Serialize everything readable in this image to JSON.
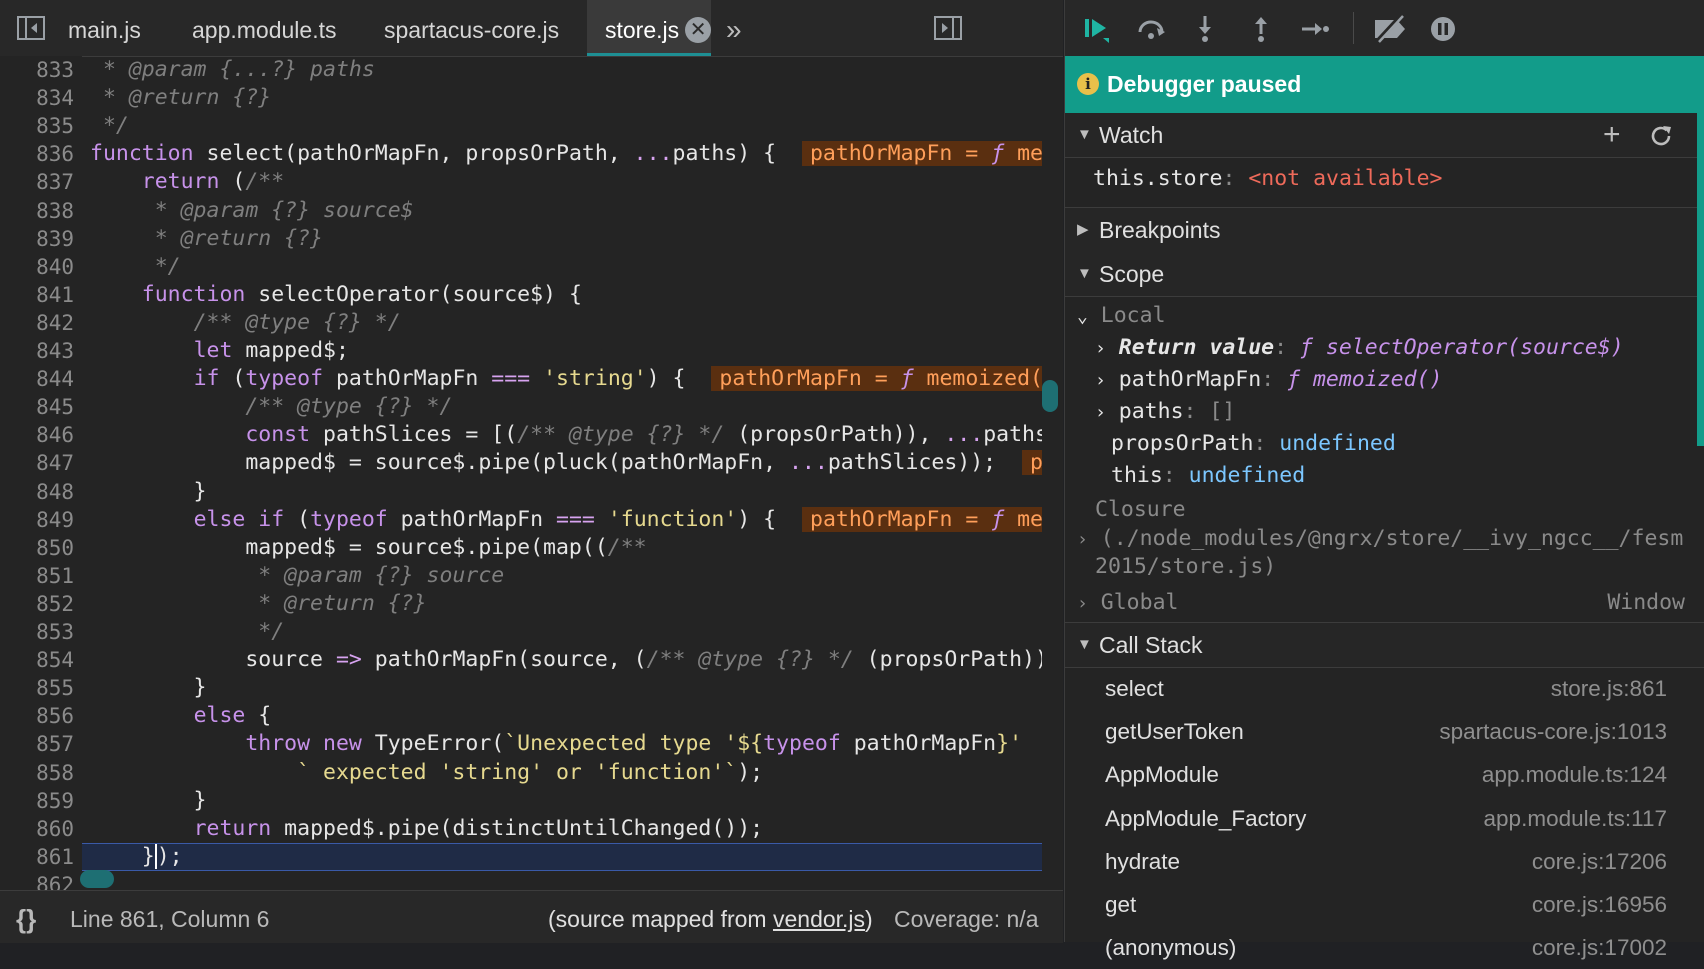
{
  "tabs": [
    {
      "label": "main.js"
    },
    {
      "label": "app.module.ts"
    },
    {
      "label": "spartacus-core.js"
    },
    {
      "label": "store.js",
      "active": true
    }
  ],
  "tab_close_glyph": "✕",
  "tab_overflow_glyph": "»",
  "code": {
    "lines": [
      {
        "n": "833",
        "html": "<span class=\"cm\"> * @param {...?} paths</span>"
      },
      {
        "n": "834",
        "html": "<span class=\"cm\"> * @return {?}</span>"
      },
      {
        "n": "835",
        "html": "<span class=\"cm\"> */</span>"
      },
      {
        "n": "836",
        "html": "<span class=\"kw\">function</span> select(pathOrMapFn, propsOrPath, <span class=\"op\">...</span>paths) {  <span class=\"inl\">pathOrMapFn = <span class=\"fn\">ƒ</span> memoized()</span>"
      },
      {
        "n": "837",
        "html": "    <span class=\"kw\">return</span> (<span class=\"cm\">/**</span>"
      },
      {
        "n": "838",
        "html": "<span class=\"cm\">     * @param {?} source$</span>"
      },
      {
        "n": "839",
        "html": "<span class=\"cm\">     * @return {?}</span>"
      },
      {
        "n": "840",
        "html": "<span class=\"cm\">     */</span>"
      },
      {
        "n": "841",
        "html": "    <span class=\"kw\">function</span> selectOperator(source$) {"
      },
      {
        "n": "842",
        "html": "        <span class=\"cm\">/** @type {?} */</span>"
      },
      {
        "n": "843",
        "html": "        <span class=\"kw\">let</span> mapped$;"
      },
      {
        "n": "844",
        "html": "        <span class=\"kw\">if</span> (<span class=\"kw\">typeof</span> pathOrMapFn <span class=\"op\">===</span> <span class=\"str\">'string'</span>) {  <span class=\"inl\">pathOrMapFn = <span class=\"fn\">ƒ</span> memoized()</span>"
      },
      {
        "n": "845",
        "html": "            <span class=\"cm\">/** @type {?} */</span>"
      },
      {
        "n": "846",
        "html": "            <span class=\"kw\">const</span> pathSlices = [(<span class=\"cm\">/** @type {?} */</span> (propsOrPath)), <span class=\"op\">...</span>paths];"
      },
      {
        "n": "847",
        "html": "            mapped$ = source$.pipe(pluck(pathOrMapFn, <span class=\"op\">...</span>pathSlices));  <span class=\"inl\">pathSlices</span>"
      },
      {
        "n": "848",
        "html": "        }"
      },
      {
        "n": "849",
        "html": "        <span class=\"kw\">else if</span> (<span class=\"kw\">typeof</span> pathOrMapFn <span class=\"op\">===</span> <span class=\"str\">'function'</span>) {  <span class=\"inl\">pathOrMapFn = <span class=\"fn\">ƒ</span> memoized()</span>"
      },
      {
        "n": "850",
        "html": "            mapped$ = source$.pipe(map((<span class=\"cm\">/**</span>"
      },
      {
        "n": "851",
        "html": "<span class=\"cm\">             * @param {?} source</span>"
      },
      {
        "n": "852",
        "html": "<span class=\"cm\">             * @return {?}</span>"
      },
      {
        "n": "853",
        "html": "<span class=\"cm\">             */</span>"
      },
      {
        "n": "854",
        "html": "            source <span class=\"op\">=></span> pathOrMapFn(source, (<span class=\"cm\">/** @type {?} */</span> (propsOrPath)))));"
      },
      {
        "n": "855",
        "html": "        }"
      },
      {
        "n": "856",
        "html": "        <span class=\"kw\">else</span> {"
      },
      {
        "n": "857",
        "html": "            <span class=\"kw\">throw new</span> TypeError(<span class=\"str\">`Unexpected type '${</span><span class=\"kw\">typeof</span> pathOrMapFn<span class=\"str\">}'</span>"
      },
      {
        "n": "858",
        "html": "<span class=\"str\">                ` expected 'string' or 'function'`</span>);"
      },
      {
        "n": "859",
        "html": "        }"
      },
      {
        "n": "860",
        "html": "        <span class=\"kw\">return</span> mapped$.pipe(distinctUntilChanged());"
      },
      {
        "n": "861",
        "html": "    }<span style=\"border-left:2px solid #fff\"></span>);"
      },
      {
        "n": "862",
        "html": ""
      }
    ]
  },
  "status": {
    "format_glyph": "{}",
    "position": "Line 861, Column 6",
    "source_prefix": "(source mapped from ",
    "source_link": "vendor.js",
    "source_suffix": ")",
    "coverage": "Coverage: n/a"
  },
  "debugger": {
    "banner": "Debugger paused",
    "watch": {
      "title": "Watch",
      "expression": "this.store",
      "value": "<not available>"
    },
    "breakpoints_title": "Breakpoints",
    "scope": {
      "title": "Scope",
      "local_title": "Local",
      "items": [
        {
          "key": "Return value",
          "value": "ƒ selectOperator(source$)"
        },
        {
          "key": "pathOrMapFn",
          "value": "ƒ memoized()"
        },
        {
          "key": "paths",
          "value": "[]"
        },
        {
          "key": "propsOrPath",
          "value": "undefined"
        },
        {
          "key": "this",
          "value": "undefined"
        }
      ],
      "closure_title": "Closure",
      "closure_path_line1": "(./node_modules/@ngrx/store/__ivy_ngcc__/fesm",
      "closure_path_line2": "2015/store.js)",
      "global_title": "Global",
      "global_value": "Window"
    },
    "call_stack": {
      "title": "Call Stack",
      "frames": [
        {
          "name": "select",
          "location": "store.js:861"
        },
        {
          "name": "getUserToken",
          "location": "spartacus-core.js:1013"
        },
        {
          "name": "AppModule",
          "location": "app.module.ts:124"
        },
        {
          "name": "AppModule_Factory",
          "location": "app.module.ts:117"
        },
        {
          "name": "hydrate",
          "location": "core.js:17206"
        },
        {
          "name": "get",
          "location": "core.js:16956"
        },
        {
          "name": "(anonymous)",
          "location": "core.js:17002"
        }
      ]
    }
  },
  "colors": {
    "accent": "#129c8a",
    "inline_value_bg": "#5a2f10",
    "inline_value_fg": "#ff9f5a"
  }
}
